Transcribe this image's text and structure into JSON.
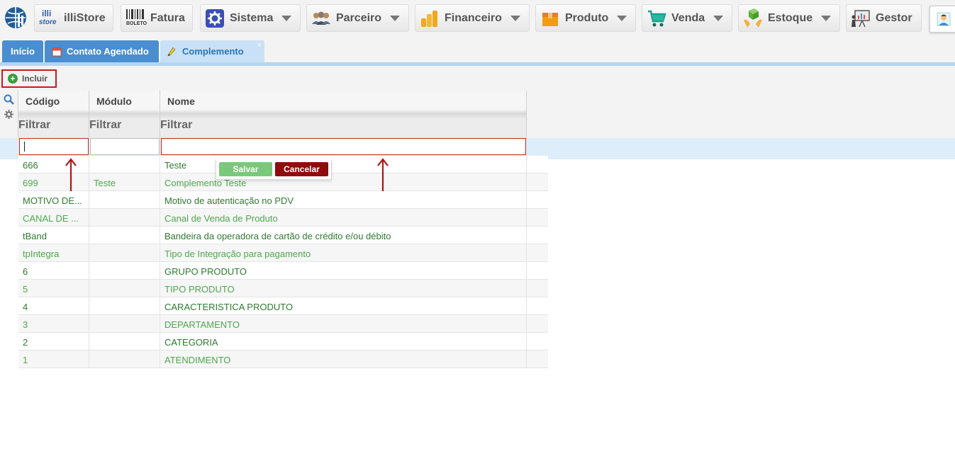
{
  "menu": {
    "items": [
      {
        "label": "illiStore",
        "icon": "illistore-logo-icon"
      },
      {
        "label": "Fatura",
        "icon": "barcode-boleto-icon"
      },
      {
        "label": "Sistema",
        "icon": "gear-icon"
      },
      {
        "label": "Parceiro",
        "icon": "users-icon"
      },
      {
        "label": "Financeiro",
        "icon": "coins-icon"
      },
      {
        "label": "Produto",
        "icon": "box-icon"
      },
      {
        "label": "Venda",
        "icon": "cart-icon"
      },
      {
        "label": "Estoque",
        "icon": "hands-box-icon"
      },
      {
        "label": "Gestor",
        "icon": "presentation-icon"
      }
    ],
    "logo_small_top": "illi",
    "logo_small_bottom": "store",
    "boleto_text": "BOLETO"
  },
  "tabs": [
    {
      "label": "Início"
    },
    {
      "label": "Contato Agendado"
    },
    {
      "label": "Complemento",
      "close": "×"
    }
  ],
  "toolbar": {
    "include_label": "Incluir"
  },
  "grid": {
    "columns": [
      "Código",
      "Módulo",
      "Nome"
    ],
    "filter_label": "Filtrar",
    "edit_values": {
      "codigo": "",
      "modulo": "",
      "nome": ""
    },
    "save_label": "Salvar",
    "cancel_label": "Cancelar",
    "rows": [
      {
        "codigo": "666",
        "modulo": "",
        "nome": "Teste"
      },
      {
        "codigo": "699",
        "modulo": "Teste",
        "nome": "Complemento Teste"
      },
      {
        "codigo": "MOTIVO DE...",
        "modulo": "",
        "nome": "Motivo de autenticação no PDV"
      },
      {
        "codigo": "CANAL DE ...",
        "modulo": "",
        "nome": "Canal de Venda de Produto"
      },
      {
        "codigo": "tBand",
        "modulo": "",
        "nome": "Bandeira da operadora de cartão de crédito e/ou débito"
      },
      {
        "codigo": "tpIntegra",
        "modulo": "",
        "nome": "Tipo de Integração para pagamento"
      },
      {
        "codigo": "6",
        "modulo": "",
        "nome": "GRUPO PRODUTO"
      },
      {
        "codigo": "5",
        "modulo": "",
        "nome": "TIPO PRODUTO"
      },
      {
        "codigo": "4",
        "modulo": "",
        "nome": "CARACTERISTICA PRODUTO"
      },
      {
        "codigo": "3",
        "modulo": "",
        "nome": "DEPARTAMENTO"
      },
      {
        "codigo": "2",
        "modulo": "",
        "nome": "CATEGORIA"
      },
      {
        "codigo": "1",
        "modulo": "",
        "nome": "ATENDIMENTO"
      }
    ]
  },
  "colors": {
    "tab_dark": "#4a8ecf",
    "tab_active": "#c9e1f6",
    "highlight_red": "#cc1a1a",
    "text_green_dark": "#2f7a2f",
    "text_green_light": "#4ea64e",
    "save_green": "#79c97b",
    "cancel_red": "#8e0c0c"
  }
}
